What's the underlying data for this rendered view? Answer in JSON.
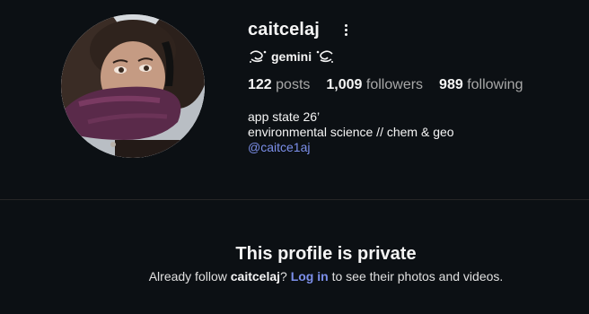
{
  "profile": {
    "username": "caitcelaj",
    "zodiac_label": "gemini",
    "stats": {
      "posts_count": "122",
      "posts_label": "posts",
      "followers_count": "1,009",
      "followers_label": "followers",
      "following_count": "989",
      "following_label": "following"
    },
    "bio": {
      "line1": "app state 26’",
      "line2": "environmental science // chem & geo",
      "linked_handle": "@caitce1aj"
    }
  },
  "private_notice": {
    "title": "This profile is private",
    "prefix": "Already follow ",
    "username": "caitcelaj",
    "question": "?",
    "login_label": "Log in",
    "suffix": " to see their photos and videos."
  },
  "icons": {
    "more": "more-options-icon",
    "zodiac_left": "gemini-swirl-icon",
    "zodiac_right": "gemini-swirl-icon"
  },
  "colors": {
    "background": "#0c1014",
    "text": "#f5f5f5",
    "muted": "#a8a8a8",
    "link": "#7c8fea",
    "divider": "#262626"
  }
}
